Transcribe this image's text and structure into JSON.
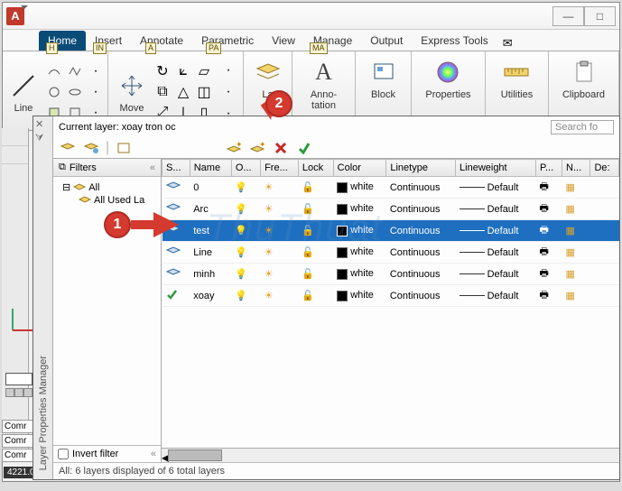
{
  "app": {
    "letter": "A"
  },
  "win_buttons": {
    "min": "—",
    "max": "□"
  },
  "tabs": [
    "Home",
    "Insert",
    "Annotate",
    "Parametric",
    "View",
    "Manage",
    "Output",
    "Express Tools"
  ],
  "tab_shortcuts": [
    "H",
    "IN",
    "A",
    "PA",
    "",
    "MA",
    "",
    "",
    ""
  ],
  "envelope": "✉",
  "panels": {
    "line": "Line",
    "move": "Move",
    "anno": "Anno-\ntation",
    "la_label": "La",
    "block": "Block",
    "properties": "Properties",
    "utilities": "Utilities",
    "clipboard": "Clipboard"
  },
  "command_lines": [
    "Comr",
    "Comr",
    "Comr"
  ],
  "coord": "4221.0",
  "layer_panel": {
    "title_vert": "Layer Properties Manager",
    "top_label": "Current layer: xoay tron oc",
    "search_placeholder": "Search fo",
    "filters_label": "Filters",
    "tree": {
      "root": "All",
      "child": "All Used La"
    },
    "invert_label": "Invert filter",
    "columns": [
      "S...",
      "Name",
      "O...",
      "Fre...",
      "Lock",
      "Color",
      "Linetype",
      "Lineweight",
      "P...",
      "N...",
      "De:"
    ],
    "rows": [
      {
        "name": "0",
        "color": "white",
        "ltype": "Continuous",
        "lw": "Default"
      },
      {
        "name": "Arc",
        "color": "white",
        "ltype": "Continuous",
        "lw": "Default"
      },
      {
        "name": "test",
        "color": "white",
        "ltype": "Continuous",
        "lw": "Default",
        "selected": true
      },
      {
        "name": "Line",
        "color": "white",
        "ltype": "Continuous",
        "lw": "Default"
      },
      {
        "name": "minh",
        "color": "white",
        "ltype": "Continuous",
        "lw": "Default"
      },
      {
        "name": "xoay",
        "color": "white",
        "ltype": "Continuous",
        "lw": "Default"
      }
    ],
    "status": "All: 6 layers displayed of 6 total layers"
  },
  "callouts": {
    "one": "1",
    "two": "2"
  },
  "watermark": "ThuThuat"
}
